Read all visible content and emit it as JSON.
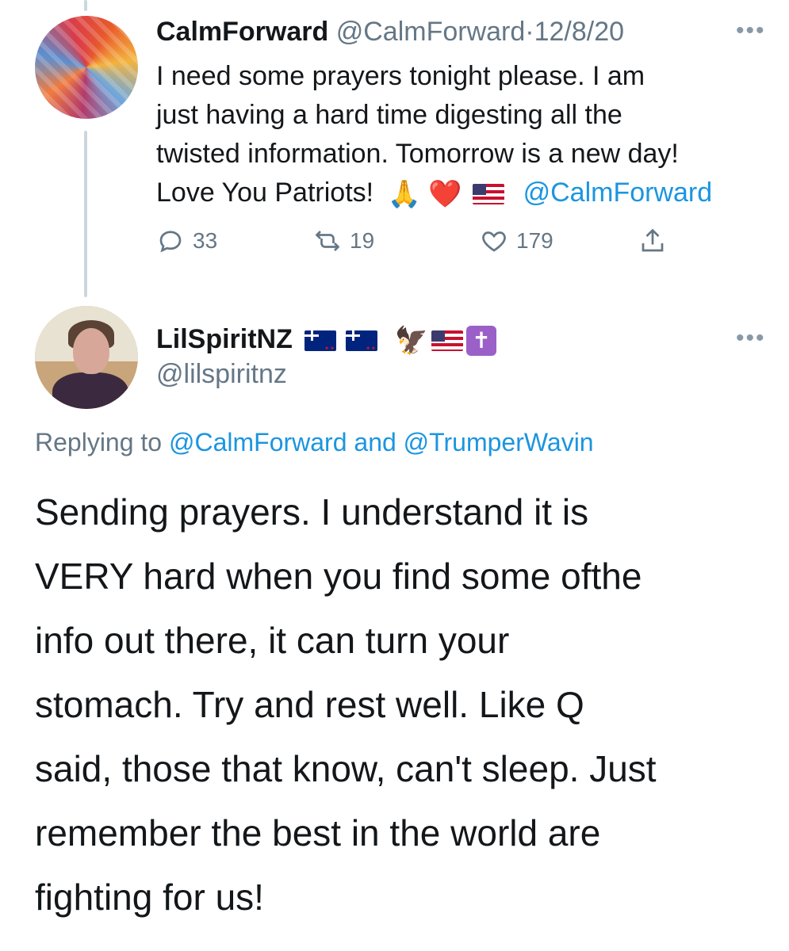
{
  "parent_tweet": {
    "display_name": "CalmForward",
    "handle": "@CalmForward",
    "separator": "·",
    "date": "12/8/20",
    "more": "•••",
    "text_lines": [
      "I need some prayers tonight please. I am",
      "just having a hard time digesting all the",
      "twisted information. Tomorrow is a new day!"
    ],
    "last_line_text": "Love You Patriots!",
    "last_line_emojis": [
      "🙏",
      "❤️"
    ],
    "mention": "@CalmForward",
    "counts": {
      "replies": "33",
      "retweets": "19",
      "likes": "179"
    },
    "icons": [
      "reply-icon",
      "retweet-icon",
      "like-icon",
      "share-icon"
    ]
  },
  "reply_tweet": {
    "display_name": "LilSpiritNZ",
    "name_emojis": [
      "🦅",
      "✝"
    ],
    "handle": "@lilspiritnz",
    "more": "•••",
    "replying_prefix": "Replying to",
    "replying_user1": "@CalmForward",
    "replying_and": "and",
    "replying_user2": "@TrumperWavin",
    "body_lines": [
      "Sending prayers. I understand it is",
      "VERY hard when you find some ofthe",
      "info out there, it can turn your",
      "stomach. Try and rest well. Like Q",
      "said, those that know, can't sleep. Just",
      "remember the best in the world are",
      "fighting for us!"
    ]
  },
  "colors": {
    "link": "#1b95e0",
    "muted": "#657786",
    "thread_line": "#ccd6dd"
  }
}
